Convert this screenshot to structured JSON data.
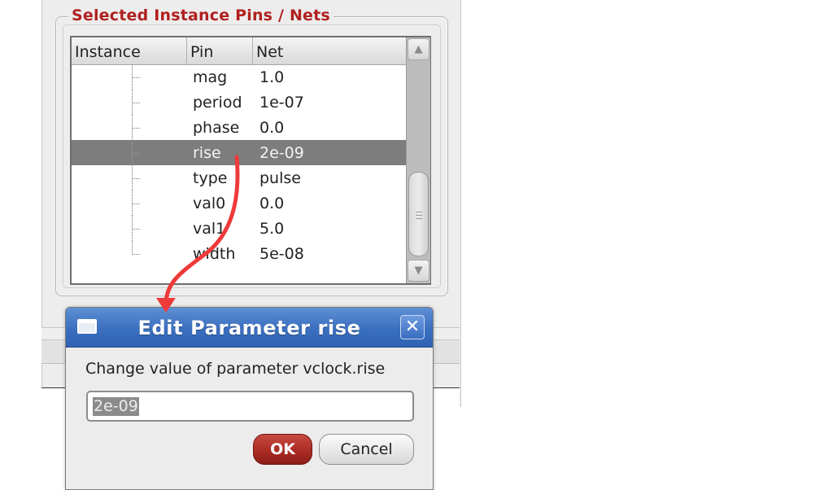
{
  "group": {
    "title": "Selected Instance Pins / Nets"
  },
  "table": {
    "columns": [
      "Instance",
      "Pin",
      "Net"
    ],
    "rows": [
      {
        "pin": "mag",
        "net": "1.0",
        "selected": false
      },
      {
        "pin": "period",
        "net": "1e-07",
        "selected": false
      },
      {
        "pin": "phase",
        "net": "0.0",
        "selected": false
      },
      {
        "pin": "rise",
        "net": "2e-09",
        "selected": true
      },
      {
        "pin": "type",
        "net": "pulse",
        "selected": false
      },
      {
        "pin": "val0",
        "net": "0.0",
        "selected": false
      },
      {
        "pin": "val1",
        "net": "5.0",
        "selected": false
      },
      {
        "pin": "width",
        "net": "5e-08",
        "selected": false
      }
    ],
    "scrollbar": {
      "up_icon": "triangle-up-icon",
      "down_icon": "triangle-down-icon"
    }
  },
  "dialog": {
    "title": "Edit Parameter rise",
    "close_icon": "close-x-icon",
    "prompt": "Change value of parameter vclock.rise",
    "value": "2e-09",
    "ok_label": "OK",
    "cancel_label": "Cancel"
  },
  "colors": {
    "group_title": "#b0201f",
    "selected_row": "#7d7d7d",
    "titlebar": "#3b6fbf",
    "ok_button": "#a82a22",
    "annotation_arrow": "#ee3a3a"
  }
}
